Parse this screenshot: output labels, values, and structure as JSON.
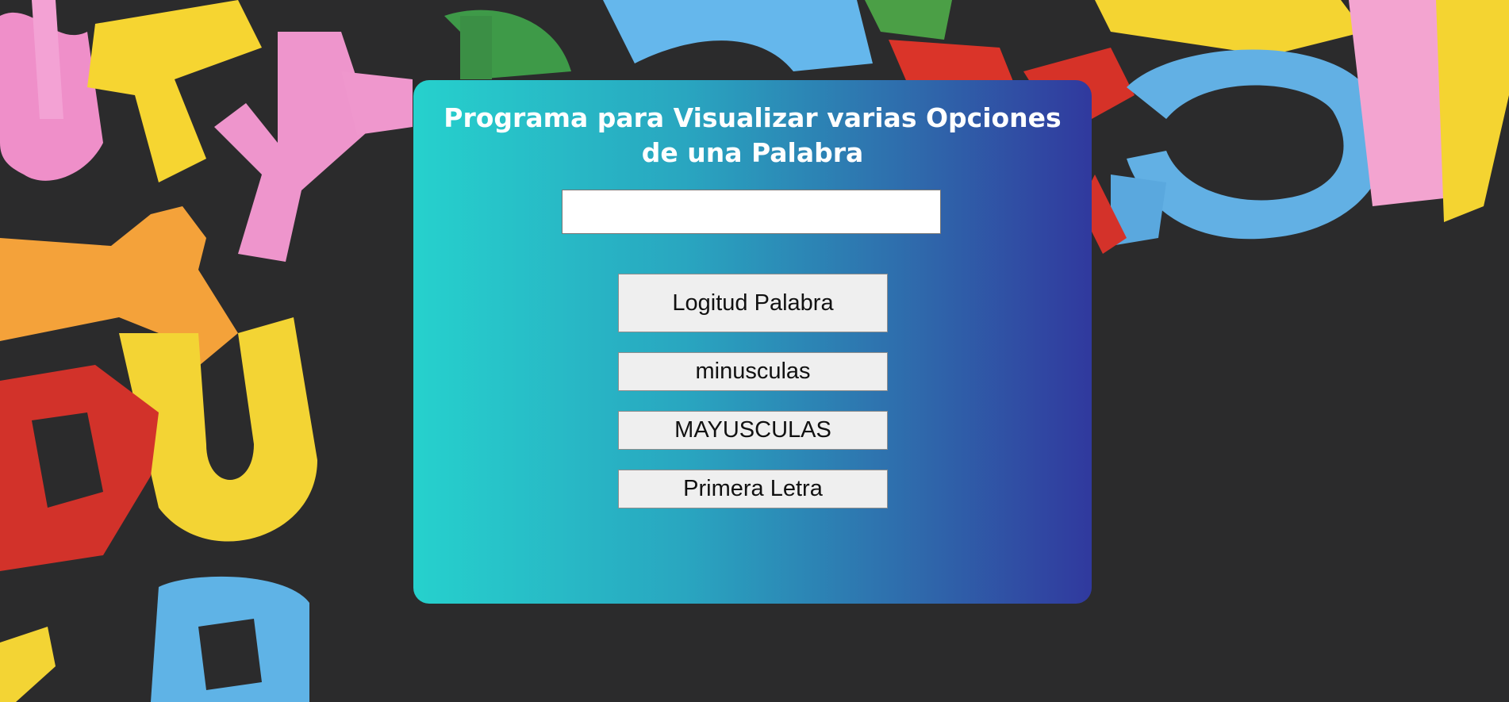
{
  "page": {
    "title": "Programa para Visualizar varias Opciones de una Palabra"
  },
  "form": {
    "word_input_value": "",
    "word_input_placeholder": ""
  },
  "buttons": {
    "length_label": "Logitud Palabra",
    "lowercase_label": "minusculas",
    "uppercase_label": "MAYUSCULAS",
    "first_letter_label": "Primera Letra"
  },
  "colors": {
    "background": "#2b2b2c",
    "card_gradient_start": "#26d1cd",
    "card_gradient_end": "#30399e",
    "button_bg": "#efefef"
  }
}
